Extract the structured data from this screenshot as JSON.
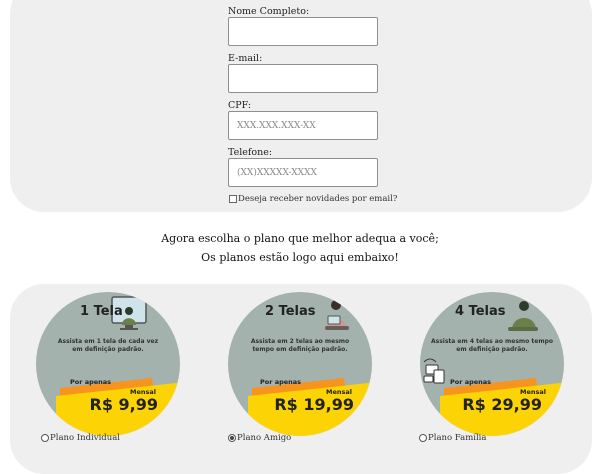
{
  "form": {
    "name_label": "Nome Completo:",
    "email_label": "E-mail:",
    "cpf_label": "CPF:",
    "cpf_placeholder": "XXX.XXX.XXX-XX",
    "phone_label": "Telefone:",
    "phone_placeholder": "(XX)XXXXX-XXXX",
    "newsletter_label": "Deseja receber novidades por email?"
  },
  "intro": {
    "line1": "Agora escolha o plano que melhor adequa a você;",
    "line2": "Os planos estão logo aqui embaixo!"
  },
  "plans": [
    {
      "title": "1 Tela",
      "desc1": "Assista em 1 tela de cada vez",
      "desc2": "em definição padrão.",
      "promo": "Por apenas",
      "period": "Mensal",
      "price": "R$ 9,99",
      "option_label": "Plano Individual",
      "selected": false
    },
    {
      "title": "2 Telas",
      "desc1": "Assista em 2 telas ao mesmo",
      "desc2": "tempo em definição padrão.",
      "promo": "Por apenas",
      "period": "Mensal",
      "price": "R$ 19,99",
      "option_label": "Plano Amigo",
      "selected": true
    },
    {
      "title": "4 Telas",
      "desc1": "Assista em 4 telas ao mesmo tempo",
      "desc2": "em definição padrão.",
      "promo": "Por apenas",
      "period": "Mensal",
      "price": "R$ 29,99",
      "option_label": "Plano Família",
      "selected": false
    }
  ],
  "colors": {
    "circle": "#a3b2ad",
    "orange": "#f7941d",
    "yellow": "#fcd405",
    "dark": "#222222"
  },
  "icons": [
    "monitor-icon",
    "person-icon",
    "devices-icon"
  ]
}
